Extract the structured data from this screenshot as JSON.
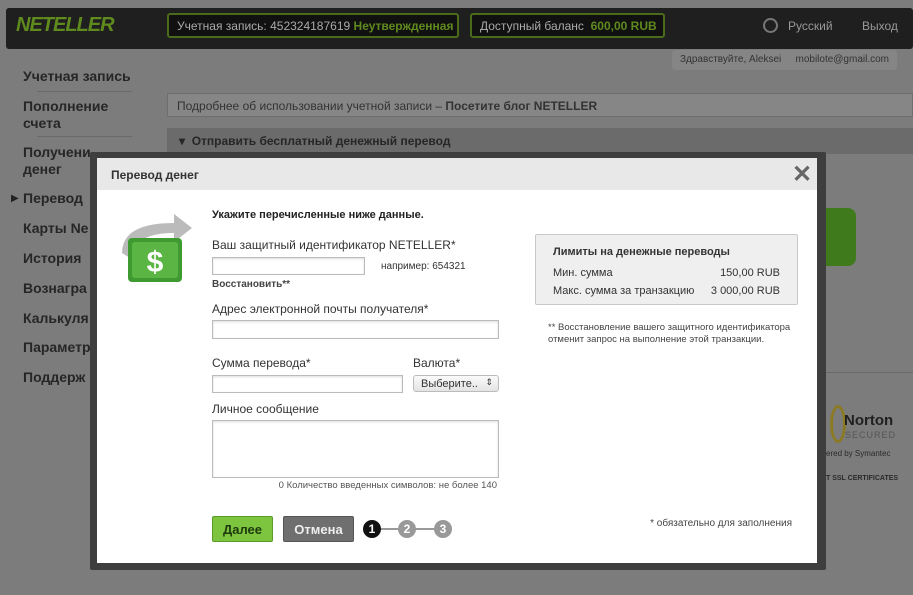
{
  "header": {
    "logo": "NETELLER",
    "account_label": "Учетная запись:",
    "account_number": "452324187619",
    "account_status": "Неутвержденная",
    "balance_label": "Доступный баланс",
    "balance_value": "600,00 RUB",
    "language": "Русский",
    "logout": "Выход",
    "greeting": "Здравствуйте, Aleksei",
    "email": "mobilote@gmail.com"
  },
  "sidebar": {
    "items": [
      {
        "label": "Учетная запись"
      },
      {
        "label": "Пополнение счета"
      },
      {
        "label": "Получени денег"
      },
      {
        "label": "Перевод"
      },
      {
        "label": "Карты Ne"
      },
      {
        "label": "История"
      },
      {
        "label": "Вознагра"
      },
      {
        "label": "Калькуля"
      },
      {
        "label": "Параметр"
      },
      {
        "label": "Поддерж"
      }
    ]
  },
  "main": {
    "blog_text": "Подробнее об использовании учетной записи – ",
    "blog_link": "Посетите блог NETELLER",
    "section_title": "Отправить бесплатный денежный перевод",
    "norton": "Norton",
    "norton_sub": "SECURED",
    "symantec": "ered by Symantec",
    "ssl": "T SSL CERTIFICATES"
  },
  "modal": {
    "title": "Перевод денег",
    "instructions": "Укажите перечисленные ниже данные.",
    "secure_id_label": "Ваш защитный идентификатор NETELLER*",
    "secure_id_value": "",
    "secure_id_hint": "например: 654321",
    "restore_link": "Восстановить**",
    "email_label": "Адрес электронной почты получателя*",
    "email_value": "",
    "amount_label": "Сумма перевода*",
    "amount_value": "",
    "currency_label": "Валюта*",
    "currency_selected": "Выберите..",
    "message_label": "Личное сообщение",
    "message_value": "",
    "counter": "0 Количество введенных символов: не более 140",
    "next": "Далее",
    "cancel": "Отмена",
    "steps": [
      "1",
      "2",
      "3"
    ],
    "current_step": 1,
    "required_note": "* обязательно для заполнения",
    "limits": {
      "title": "Лимиты на денежные переводы",
      "rows": [
        {
          "label": "Мин. сумма",
          "value": "150,00 RUB"
        },
        {
          "label": "Макс. сумма за транзакцию",
          "value": "3 000,00 RUB"
        }
      ]
    },
    "restore_note": "** Восстановление вашего защитного идентификатора отменит запрос на выполнение этой транзакции."
  },
  "colors": {
    "accent": "#7dc43f",
    "dark": "#1f1f1f"
  }
}
